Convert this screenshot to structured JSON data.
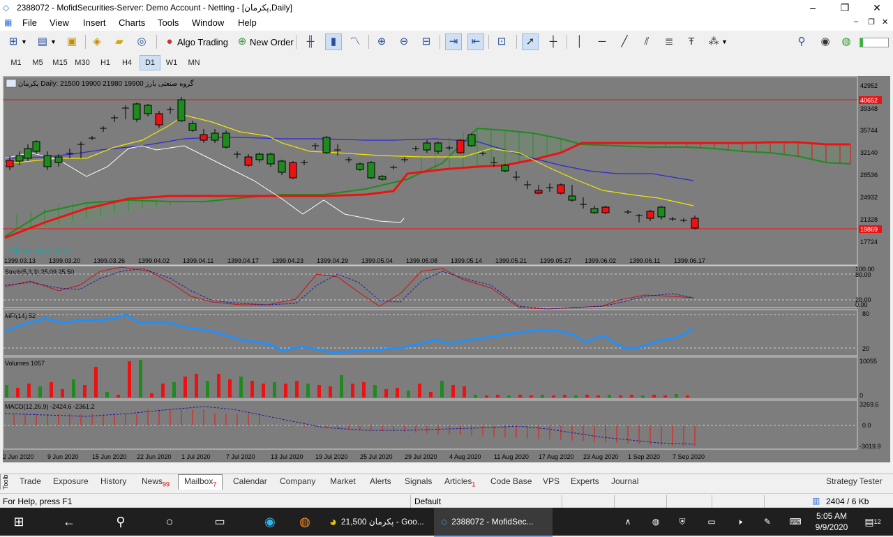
{
  "window": {
    "title": "2388072 - MofidSecurities-Server: Demo Account - Netting - [پکرمان,Daily]",
    "minimize": "–",
    "restore": "❐",
    "close": "✕"
  },
  "menu": [
    "File",
    "View",
    "Insert",
    "Charts",
    "Tools",
    "Window",
    "Help"
  ],
  "toolbar": {
    "algo_trading": "Algo Trading",
    "new_order": "New Order"
  },
  "timeframes": [
    "M1",
    "M5",
    "M15",
    "M30",
    "H1",
    "H4",
    "D1",
    "W1",
    "MN"
  ],
  "active_timeframe": "D1",
  "chart": {
    "header": "پکرمان Daily:  21500 19900 21980 19900  گروه صنعتی بارز",
    "watermark": "Mofid Securities",
    "price_ticks": [
      "42952",
      "39348",
      "35744",
      "32140",
      "28536",
      "24932",
      "21328",
      "17724"
    ],
    "line_top_label": "40652",
    "line_bottom_label": "19869",
    "top_dates": [
      "1399.03.13",
      "1399.03.20",
      "1399.03.26",
      "1399.04.02",
      "1399.04.11",
      "1399.04.17",
      "1399.04.23",
      "1399.04.29",
      "1399.05.04",
      "1399.05.08",
      "1399.05.14",
      "1399.05.21",
      "1399.05.27",
      "1399.06.02",
      "1399.06.11",
      "1399.06.17"
    ],
    "bottom_dates": [
      "2 Jun 2020",
      "9 Jun 2020",
      "15 Jun 2020",
      "22 Jun 2020",
      "1 Jul 2020",
      "7 Jul 2020",
      "13 Jul 2020",
      "19 Jul 2020",
      "25 Jul 2020",
      "29 Jul 2020",
      "4 Aug 2020",
      "11 Aug 2020",
      "17 Aug 2020",
      "23 Aug 2020",
      "1 Sep 2020",
      "7 Sep 2020"
    ],
    "stoch": {
      "label": "Stoch(5,3,3) 25.09 25.50",
      "ticks": [
        "100.00",
        "80.00",
        "20.00",
        "0.00"
      ]
    },
    "mfi": {
      "label": "MFI(14) 52",
      "ticks": [
        "80",
        "20"
      ]
    },
    "volumes": {
      "label": "Volumes 1057",
      "ticks": [
        "10055",
        "0"
      ]
    },
    "macd": {
      "label": "MACD(12,26,9) -2424.6 -2361.2",
      "ticks": [
        "3269.6",
        "0.0",
        "-3019.9"
      ]
    }
  },
  "tabs": {
    "toolbox": "Toolbox",
    "items": [
      {
        "label": "Trade",
        "badge": ""
      },
      {
        "label": "Exposure",
        "badge": ""
      },
      {
        "label": "History",
        "badge": ""
      },
      {
        "label": "News",
        "badge": "99"
      },
      {
        "label": "Mailbox",
        "badge": "7"
      },
      {
        "label": "Calendar",
        "badge": ""
      },
      {
        "label": "Company",
        "badge": ""
      },
      {
        "label": "Market",
        "badge": ""
      },
      {
        "label": "Alerts",
        "badge": ""
      },
      {
        "label": "Signals",
        "badge": ""
      },
      {
        "label": "Articles",
        "badge": "1"
      },
      {
        "label": "Code Base",
        "badge": ""
      },
      {
        "label": "VPS",
        "badge": ""
      },
      {
        "label": "Experts",
        "badge": ""
      },
      {
        "label": "Journal",
        "badge": ""
      }
    ],
    "active": "Mailbox",
    "strategy_tester": "Strategy Tester"
  },
  "status": {
    "help": "For Help, press F1",
    "profile": "Default",
    "traffic": "2404 / 6 Kb"
  },
  "taskbar": {
    "app1": "پکرمان 21,500 - Goo...",
    "app2": "2388072 - MofidSec...",
    "time": "5:05 AM",
    "date": "9/9/2020",
    "notifications": "12"
  }
}
